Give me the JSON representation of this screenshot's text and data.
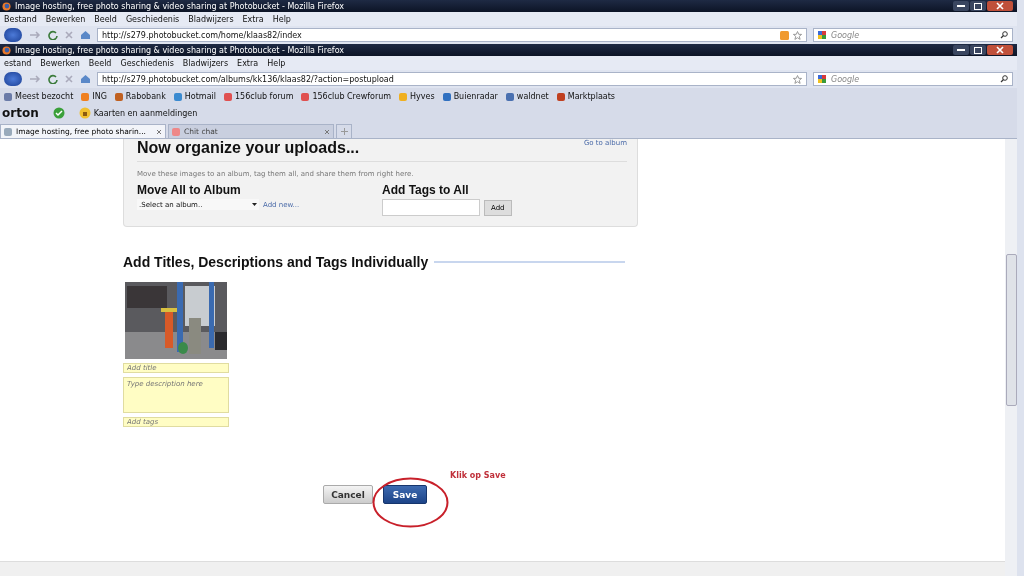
{
  "outer_window": {
    "title": "Image hosting, free photo sharing & video sharing at Photobucket - Mozilla Firefox",
    "menu": [
      "Bestand",
      "Bewerken",
      "Beeld",
      "Geschiedenis",
      "Bladwijzers",
      "Extra",
      "Help"
    ],
    "address": "http://s279.photobucket.com/home/klaas82/index",
    "search_placeholder": "Google"
  },
  "inner_window": {
    "title": "Image hosting, free photo sharing & video sharing at Photobucket - Mozilla Firefox",
    "menu": [
      "estand",
      "Bewerken",
      "Beeld",
      "Geschiedenis",
      "Bladwijzers",
      "Extra",
      "Help"
    ],
    "address": "http://s279.photobucket.com/albums/kk136/klaas82/?action=postupload",
    "search_placeholder": "Google",
    "bookmarks": [
      {
        "label": "Meest bezocht",
        "color": "#6a7ba8"
      },
      {
        "label": "ING",
        "color": "#f08020"
      },
      {
        "label": "Rabobank",
        "color": "#c06020"
      },
      {
        "label": "Hotmail",
        "color": "#3a8ad0"
      },
      {
        "label": "156club forum",
        "color": "#e05050"
      },
      {
        "label": "156club Crewforum",
        "color": "#e05050"
      },
      {
        "label": "Hyves",
        "color": "#f0b020"
      },
      {
        "label": "Buienradar",
        "color": "#3070c0"
      },
      {
        "label": "waldnet",
        "color": "#4a70b0"
      },
      {
        "label": "Marktplaats",
        "color": "#c04020"
      }
    ],
    "norton": {
      "label": "orton",
      "menu_label": "Kaarten en aanmeldingen"
    },
    "tabs": [
      {
        "label": "Image hosting, free photo sharin...",
        "selected": true
      },
      {
        "label": "Chit chat",
        "selected": false
      }
    ]
  },
  "page": {
    "card": {
      "title": "Now organize your uploads...",
      "link": "Go to album",
      "intro": "Move these images to an album, tag them all, and share them from right here.",
      "album_heading": "Move All to Album",
      "album_select": ".Select an album..",
      "add_new": "Add new...",
      "tags_heading": "Add Tags to All",
      "add_button": "Add"
    },
    "section_title": "Add Titles, Descriptions and Tags Individually",
    "photo": {
      "kind": "picture",
      "title_placeholder": "Add title",
      "description_placeholder": "Type description here",
      "tags_placeholder": "Add tags"
    },
    "buttons": {
      "cancel": "Cancel",
      "save": "Save"
    },
    "annotation": "Klik op Save"
  }
}
